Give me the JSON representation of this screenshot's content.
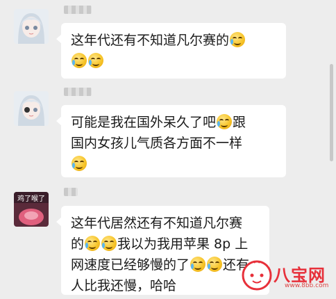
{
  "messages": [
    {
      "lines": [
        [
          "这年代还有不知道凡尔赛的",
          "E"
        ],
        [
          "E",
          "E"
        ]
      ]
    },
    {
      "lines": [
        [
          "可能是我在国外呆久了吧",
          "E",
          "跟"
        ],
        [
          "国内女孩儿气质各方面不一样"
        ],
        [
          "E"
        ]
      ]
    },
    {
      "avatar_caption": "鸡了喉了",
      "lines": [
        [
          "这年代居然还有不知道凡尔赛"
        ],
        [
          "的",
          "E",
          "E",
          "我以为我用苹果 8p 上"
        ],
        [
          "网速度已经够慢的了",
          "E",
          "E",
          "还有"
        ],
        [
          "人比我还慢，哈哈"
        ]
      ]
    }
  ],
  "watermark": {
    "brand": "八宝网",
    "url": "www.8bb.com"
  },
  "emoji_name": "face-with-tears-of-joy-icon",
  "colors": {
    "background": "#ededed",
    "bubble": "#ffffff",
    "text": "#1a1a1a",
    "watermark": "#e7303a"
  }
}
